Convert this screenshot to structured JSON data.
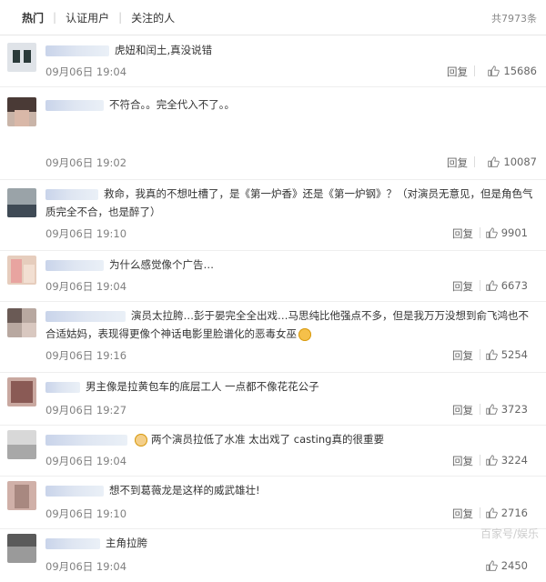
{
  "tabs": [
    {
      "label": "热门"
    },
    {
      "label": "认证用户"
    },
    {
      "label": "关注的人"
    }
  ],
  "total": "共7973条",
  "reply_label": "回复",
  "comments": [
    {
      "text": "虎妞和闰土,真没说错",
      "date": "09月06日 19:04",
      "likes": "15686"
    },
    {
      "text": "不符合。。完全代入不了。。",
      "date": "09月06日 19:02",
      "likes": "10087"
    },
    {
      "text": "救命，我真的不想吐槽了，是《第一炉香》还是《第一炉钢》？（对演员无意见，但是角色气质完全不合，也是醉了）",
      "date": "09月06日 19:10",
      "likes": "9901"
    },
    {
      "text": "为什么感觉像个广告…",
      "date": "09月06日 19:04",
      "likes": "6673"
    },
    {
      "text": "演员太拉胯…彭于晏完全全出戏…马思纯比他强点不多，但是我万万没想到俞飞鸿也不合适姑妈，表现得更像个神话电影里脸谱化的恶毒女巫",
      "date": "09月06日 19:16",
      "likes": "5254"
    },
    {
      "text": "男主像是拉黄包车的底层工人 一点都不像花花公子",
      "date": "09月06日 19:27",
      "likes": "3723"
    },
    {
      "text": "两个演员拉低了水准 太出戏了 casting真的很重要",
      "date": "09月06日 19:04",
      "likes": "3224"
    },
    {
      "text": "想不到葛薇龙是这样的威武雄壮!",
      "date": "09月06日 19:10",
      "likes": "2716"
    },
    {
      "text": "主角拉胯",
      "date": "09月06日 19:04",
      "likes": "2450"
    }
  ],
  "watermark": "百家号/娱乐"
}
